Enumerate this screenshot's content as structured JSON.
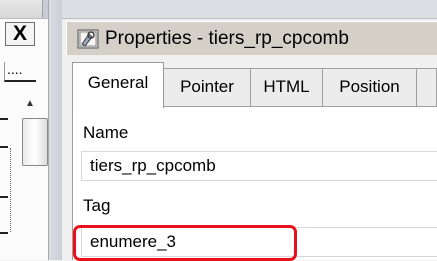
{
  "left_panel": {
    "close_label": "X",
    "ellipsis_label": "....",
    "scroll_up_arrow": "▲"
  },
  "properties_window": {
    "title": "Properties - tiers_rp_cpcomb",
    "icon": "properties-icon",
    "tabs": [
      {
        "label": "General",
        "active": true
      },
      {
        "label": "Pointer",
        "active": false
      },
      {
        "label": "HTML",
        "active": false
      },
      {
        "label": "Position",
        "active": false
      }
    ],
    "fields": {
      "name_label": "Name",
      "name_value": "tiers_rp_cpcomb",
      "tag_label": "Tag",
      "tag_value": "enumere_3"
    },
    "highlight_color": "#e8111b"
  }
}
